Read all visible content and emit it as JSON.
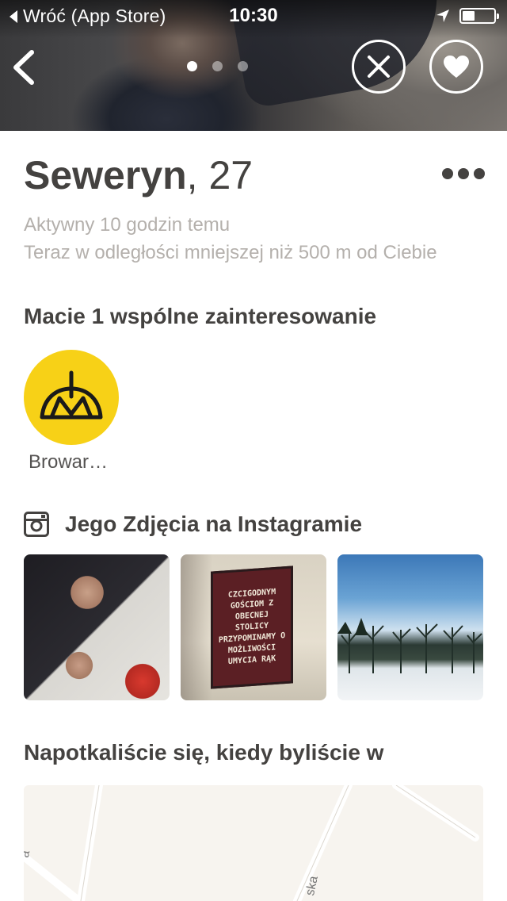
{
  "status_bar": {
    "back_app_label": "Wróć (App Store)",
    "time": "10:30",
    "battery_level": 0.4
  },
  "photo_pager": {
    "count": 3,
    "active_index": 0
  },
  "profile": {
    "name": "Seweryn",
    "separator": ",",
    "age": "27",
    "active_text": "Aktywny 10 godzin temu",
    "distance_text": "Teraz w odległości mniejszej niż 500 m od Ciebie"
  },
  "interests": {
    "title": "Macie 1 wspólne zainteresowanie",
    "items": [
      {
        "label": "Browar…",
        "color": "#f7d117"
      }
    ]
  },
  "instagram": {
    "title": "Jego Zdjęcia na Instagramie",
    "photo2_sign_lines": [
      "CZCIGODNYM",
      "GOŚCIOM Z",
      "OBECNEJ STOLICY",
      "PRZYPOMINAMY O",
      "MOŻLIWOŚCI",
      "UMYCIA RĄK"
    ]
  },
  "met": {
    "title": "Napotkaliście się, kiedy byliście w",
    "map_label_1": "ska",
    "map_label_2": "a"
  },
  "colors": {
    "interest_badge": "#f7d117",
    "text_primary": "#444240",
    "text_muted": "#b4b0ac",
    "map_bg": "#f7f4ef"
  },
  "icons": {
    "back": "chevron-left-icon",
    "pass": "close-icon",
    "like": "heart-icon",
    "more": "more-dots-icon",
    "instagram": "instagram-icon",
    "interest": "brewery-logo-icon",
    "location": "location-arrow-icon"
  }
}
